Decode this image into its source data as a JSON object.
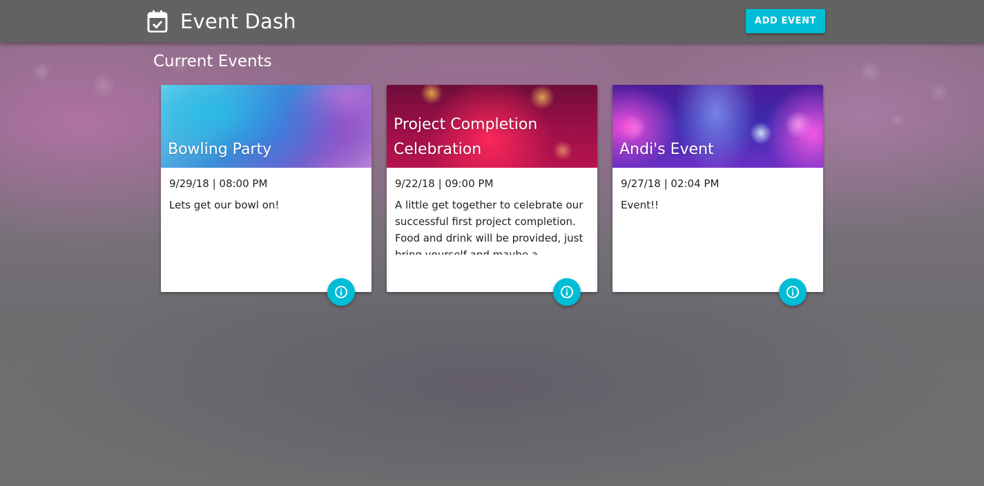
{
  "app": {
    "title": "Event Dash",
    "icon": "calendar-check-icon"
  },
  "toolbar": {
    "add_label": "ADD EVENT"
  },
  "section": {
    "title": "Current Events"
  },
  "colors": {
    "accent": "#00bcd4",
    "topbar": "#626262"
  },
  "events": [
    {
      "title": "Bowling Party",
      "datetime": "9/29/18 | 08:00 PM",
      "description": "Lets get our bowl on!",
      "image": "watercolor-image",
      "action_icon": "info-icon"
    },
    {
      "title": "Project Completion Celebration",
      "datetime": "9/22/18 | 09:00 PM",
      "description": "A little get together to celebrate our successful first project completion. Food and drink will be provided, just bring yourself and maybe a",
      "image": "fireworks-image",
      "action_icon": "info-icon"
    },
    {
      "title": "Andi's Event",
      "datetime": "9/27/18 | 02:04 PM",
      "description": "Event!!",
      "image": "stage-lights-image",
      "action_icon": "info-icon"
    }
  ]
}
